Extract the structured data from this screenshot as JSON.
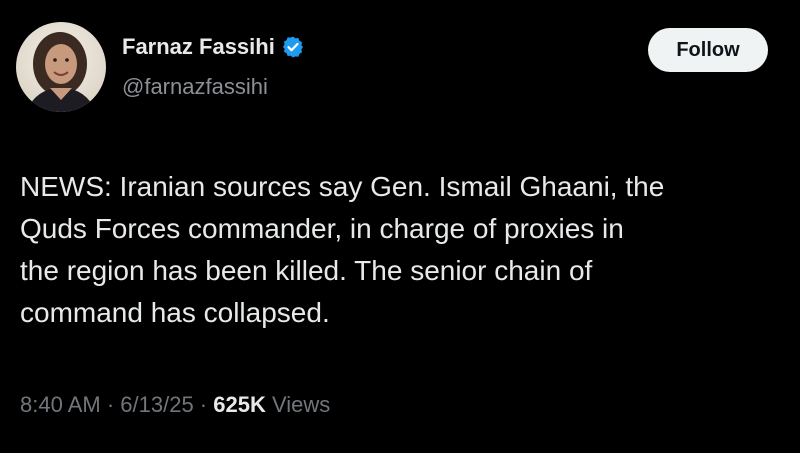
{
  "author": {
    "display_name": "Farnaz Fassihi",
    "handle": "@farnazfassihi",
    "verified": true,
    "avatar_icon": "profile-photo",
    "verified_color": "#1d9bf0"
  },
  "follow_button": {
    "label": "Follow"
  },
  "tweet": {
    "lines": [
      "NEWS: Iranian sources say Gen. Ismail Ghaani, the",
      "Quds Forces commander, in charge of proxies in",
      "the region has been killed. The senior chain of",
      "command has collapsed."
    ]
  },
  "meta": {
    "time": "8:40 AM",
    "separator1": " · ",
    "date": "6/13/25",
    "separator2": " · ",
    "views_count": "625K",
    "views_label": " Views"
  },
  "colors": {
    "background": "#000000",
    "text_primary": "#e7e9ea",
    "text_secondary": "#71767b",
    "follow_bg": "#eff3f4"
  }
}
